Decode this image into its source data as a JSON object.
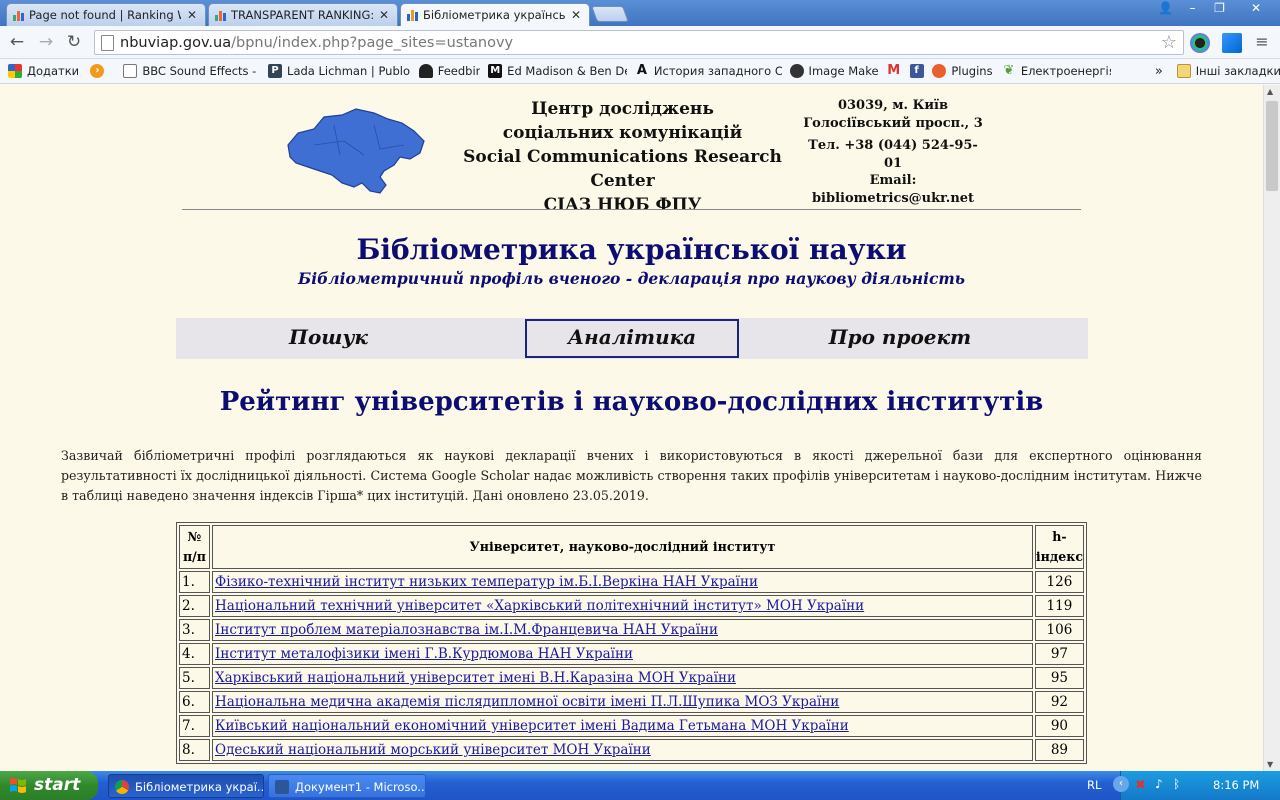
{
  "browser": {
    "tabs": [
      {
        "title": "Page not found | Ranking We",
        "active": false
      },
      {
        "title": "TRANSPARENT RANKING: To",
        "active": false
      },
      {
        "title": "Бібліометрика української н",
        "active": true
      }
    ],
    "url_host": "nbuviap.gov.ua",
    "url_path": "/bpnu/index.php?page_sites=ustanovy",
    "bookmarks": [
      {
        "label": "Додатки",
        "icon": "apps-icon",
        "color": "#d33"
      },
      {
        "label": "",
        "icon": "orange-badge-icon",
        "color": "#f29a1b"
      },
      {
        "label": "BBC Sound Effects - Res",
        "icon": "page-icon",
        "color": "#888"
      },
      {
        "label": "Lada Lichman | Publons",
        "icon": "publons-icon",
        "color": "#345"
      },
      {
        "label": "Feedbin",
        "icon": "feedbin-icon",
        "color": "#222"
      },
      {
        "label": "Ed Madison & Ben DeJar",
        "icon": "medium-icon",
        "color": "#111"
      },
      {
        "label": "История западного Сре",
        "icon": "a-letter-icon",
        "color": "#222"
      },
      {
        "label": "Image Maker",
        "icon": "image-maker-icon",
        "color": "#333"
      },
      {
        "label": "",
        "icon": "gmail-icon",
        "color": "#d33"
      },
      {
        "label": "",
        "icon": "facebook-icon",
        "color": "#3b5998"
      },
      {
        "label": "Plugins",
        "icon": "plugins-icon",
        "color": "#e8602c"
      },
      {
        "label": "Електроенергія",
        "icon": "leaf-icon",
        "color": "#5a9c33"
      }
    ],
    "other_bookmarks": "Інші закладки"
  },
  "header": {
    "org_lines": [
      "Центр досліджень",
      "соціальних комунікацій",
      "Social Communications Research Center",
      "СІАЗ НЮБ ФПУ"
    ],
    "address_lines": [
      "03039, м. Київ",
      "Голосіївський просп., 3"
    ],
    "contact_lines": [
      "Тел. +38 (044) 524-95-01",
      "Email:",
      "bibliometrics@ukr.net"
    ]
  },
  "site": {
    "title": "Бібліометрика української науки",
    "subtitle": "Бібліометричний профіль вченого - декларація про наукову діяльність",
    "menu": [
      "Пошук",
      "Аналітика",
      "Про проект"
    ],
    "menu_active_index": 1
  },
  "page": {
    "heading": "Рейтинг університетів і науково-дослідних інститутів",
    "intro": "Зазвичай бібліометричні профілі розглядаються як наукові декларації вчених і використовуються в якості джерельної бази для експертного оцінювання результативності їх дослідницької діяльності. Система Google Scholar надає можливість створення таких профілів університетам і науково-дослідним інститутам. Нижче в таблиці наведено значення індексів Гірша* цих інституцій. Дані оновлено 23.05.2019."
  },
  "table": {
    "headers": [
      "№ п/п",
      "Університет, науково-дослідний інститут",
      "h-індекс"
    ],
    "rows": [
      {
        "num": "1.",
        "name": "Фізико-технічний інститут низьких температур ім.Б.І.Веркіна НАН України",
        "h": "126"
      },
      {
        "num": "2.",
        "name": "Національний технічний університет «Харківський політехнічний інститут» МОН України",
        "h": "119"
      },
      {
        "num": "3.",
        "name": "Інститут проблем матеріалознавства ім.І.М.Францевича НАН України",
        "h": "106"
      },
      {
        "num": "4.",
        "name": "Інститут металофізики імені Г.В.Курдюмова НАН України",
        "h": "97"
      },
      {
        "num": "5.",
        "name": "Харківський національний університет імені В.Н.Каразіна МОН України",
        "h": "95"
      },
      {
        "num": "6.",
        "name": "Національна медична академія післядипломної освіти імені П.Л.Шупика МОЗ України",
        "h": "92"
      },
      {
        "num": "7.",
        "name": "Київський національний економічний університет імені Вадима Гетьмана МОН України",
        "h": "90"
      },
      {
        "num": "8.",
        "name": "Одеський національний морський університет МОН України",
        "h": "89"
      }
    ]
  },
  "taskbar": {
    "start": "start",
    "items": [
      "Бібліометрика украї...",
      "Документ1 - Microso..."
    ],
    "lang": "RL",
    "time": "8:16 PM"
  }
}
